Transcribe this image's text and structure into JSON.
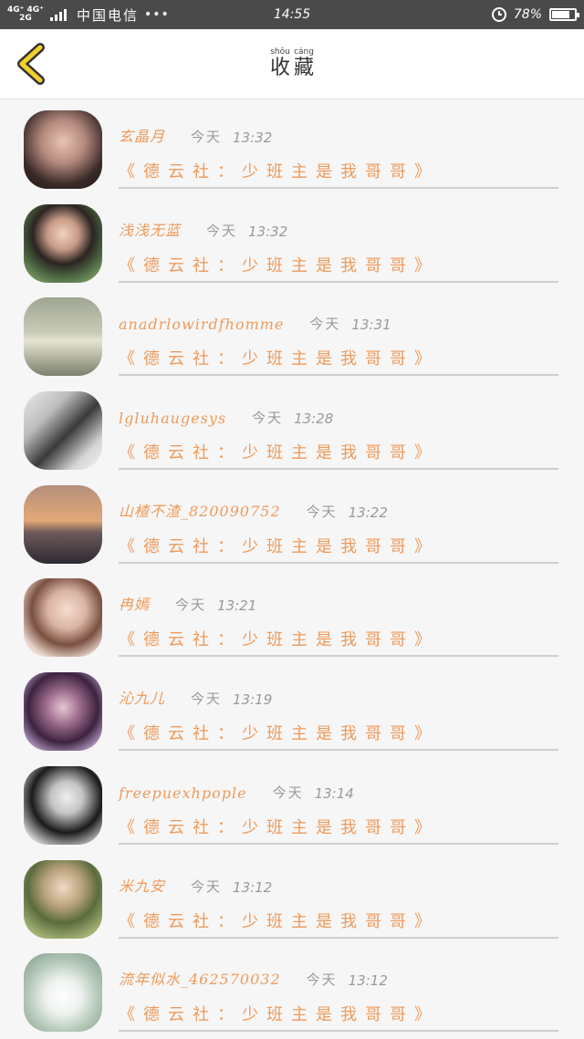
{
  "status_bar": {
    "network1": "4G⁺ 4G⁺",
    "network2": "2G",
    "carrier": "中国电信",
    "more": "•••",
    "time": "14:55",
    "battery": "78%",
    "battery_level": 0.78
  },
  "header": {
    "back_icon": "chevron-left-icon",
    "title_pinyin": [
      "shōu",
      "cáng"
    ],
    "title_chars": [
      "收",
      "藏"
    ]
  },
  "favorites": [
    {
      "name": "玄晶月",
      "date": "今天",
      "time": "13:32",
      "book": "《德云社：少班主是我哥哥》"
    },
    {
      "name": "浅浅无蓝",
      "date": "今天",
      "time": "13:32",
      "book": "《德云社：少班主是我哥哥》"
    },
    {
      "name": "anadrlowirdfhomme",
      "date": "今天",
      "time": "13:31",
      "book": "《德云社：少班主是我哥哥》"
    },
    {
      "name": "lgluhaugesys",
      "date": "今天",
      "time": "13:28",
      "book": "《德云社：少班主是我哥哥》"
    },
    {
      "name": "山楂不渣_820090752",
      "date": "今天",
      "time": "13:22",
      "book": "《德云社：少班主是我哥哥》"
    },
    {
      "name": "冉嫣",
      "date": "今天",
      "time": "13:21",
      "book": "《德云社：少班主是我哥哥》"
    },
    {
      "name": "沁九儿",
      "date": "今天",
      "time": "13:19",
      "book": "《德云社：少班主是我哥哥》"
    },
    {
      "name": "freepuexhpople",
      "date": "今天",
      "time": "13:14",
      "book": "《德云社：少班主是我哥哥》"
    },
    {
      "name": "米九安",
      "date": "今天",
      "time": "13:12",
      "book": "《德云社：少班主是我哥哥》"
    },
    {
      "name": "流年似水_462570032",
      "date": "今天",
      "time": "13:12",
      "book": "《德云社：少班主是我哥哥》"
    }
  ],
  "colors": {
    "accent": "#ef9a5a",
    "back_icon": "#f2d02a",
    "status_bar": "#4a4a4a"
  }
}
